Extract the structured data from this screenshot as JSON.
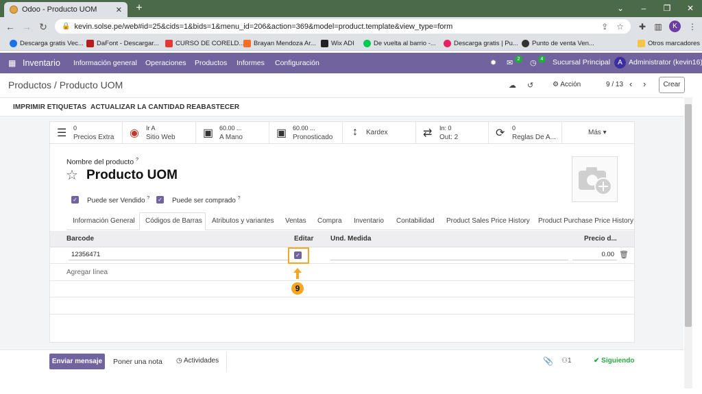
{
  "browser": {
    "tab_title": "Odoo - Producto UOM",
    "url": "kevin.solse.pe/web#id=25&cids=1&bids=1&menu_id=206&action=369&model=product.template&view_type=form",
    "profile_initial": "K",
    "bookmarks": [
      {
        "label": "Descarga gratis Vec...",
        "color": "#1a73e8"
      },
      {
        "label": "DaFont - Descargar...",
        "color": "#b71c1c"
      },
      {
        "label": "CURSO DE CORELD...",
        "color": "#e53935"
      },
      {
        "label": "Brayan Mendoza Ar...",
        "color": "#fc6d26"
      },
      {
        "label": "Wix ADI",
        "color": "#222222"
      },
      {
        "label": "De vuelta al barrio -...",
        "color": "#00c853"
      },
      {
        "label": "Descarga gratis | Pu...",
        "color": "#e91e63"
      },
      {
        "label": "Punto de venta Ven...",
        "color": "#333333"
      }
    ],
    "other_bookmarks": "Otros marcadores"
  },
  "navbar": {
    "app_name": "Inventario",
    "menu": [
      "Información general",
      "Operaciones",
      "Productos",
      "Informes",
      "Configuración"
    ],
    "messages_count": "2",
    "activities_count": "4",
    "company": "Sucursal Principal",
    "user_initial": "A",
    "user": "Administrator (kevin16)"
  },
  "control_panel": {
    "breadcrumb": "Productos / Producto UOM",
    "action_label": "Acción",
    "pager": "9 / 13",
    "create_label": "Crear"
  },
  "header_buttons": [
    "IMPRIMIR ETIQUETAS",
    "ACTUALIZAR LA CANTIDAD",
    "REABASTECER"
  ],
  "smart_buttons": [
    {
      "icon": "list-icon",
      "glyph": "☰",
      "line1": "0",
      "line2": "Precios Extra"
    },
    {
      "icon": "globe-icon",
      "glyph": "◉",
      "line1": "Ir A",
      "line2": "Sitio Web"
    },
    {
      "icon": "cubes-icon",
      "glyph": "▣",
      "line1": "60.00 ...",
      "line2": "A Mano"
    },
    {
      "icon": "cubes-icon",
      "glyph": "▣",
      "line1": "60.00 ...",
      "line2": "Pronosticado"
    },
    {
      "icon": "vertical-arrows-icon",
      "glyph": "↕",
      "line1": "",
      "line2": "Kardex"
    },
    {
      "icon": "exchange-icon",
      "glyph": "⇄",
      "line1": "In:     0",
      "line2": "Out:   2"
    },
    {
      "icon": "refresh-icon",
      "glyph": "⟳",
      "line1": "0",
      "line2": "Reglas De A..."
    },
    {
      "icon": "more-icon",
      "glyph": "",
      "line1": "",
      "line2": "Más ▾"
    }
  ],
  "form": {
    "name_label": "Nombre del producto",
    "name_help": "?",
    "product_name": "Producto UOM",
    "can_be_sold_label": "Puede ser Vendido",
    "can_be_purchased_label": "Puede ser comprado",
    "tabs": [
      "Información General",
      "Códigos de Barras",
      "Atributos y variantes",
      "Ventas",
      "Compra",
      "Inventario",
      "Contabilidad",
      "Product Sales Price History",
      "Product Purchase Price History"
    ],
    "active_tab": "Códigos de Barras"
  },
  "barcode_table": {
    "columns": [
      "Barcode",
      "Editar",
      "Und. Medida",
      "Precio d..."
    ],
    "rows": [
      {
        "barcode": "12356471",
        "editar": true,
        "uom": "",
        "price": "0.00"
      }
    ],
    "add_line": "Agregar línea"
  },
  "annotation": {
    "step": "9",
    "color": "#f5a623"
  },
  "chatter": {
    "send_message": "Enviar mensaje",
    "log_note": "Poner una nota",
    "activities": "Actividades",
    "followers_count": "1",
    "following": "Siguiendo"
  },
  "colors": {
    "brand": "#71639e",
    "success": "#28a745"
  }
}
